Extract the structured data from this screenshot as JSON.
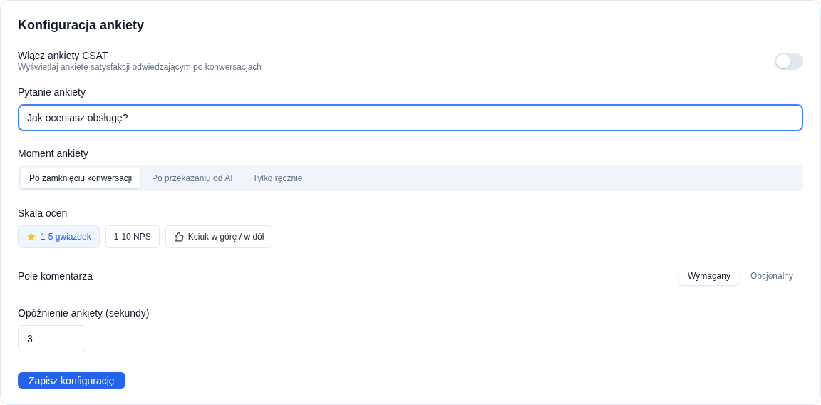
{
  "title": "Konfiguracja ankiety",
  "csat": {
    "label": "Włącz ankiety CSAT",
    "description": "Wyświetlaj ankietę satysfakcji odwiedzającym po konwersacjach",
    "on": false
  },
  "question": {
    "label": "Pytanie ankiety",
    "value": "Jak oceniasz obsługę?"
  },
  "timing": {
    "label": "Moment ankiety",
    "options": [
      {
        "label": "Po zamknięciu konwersacji",
        "selected": true
      },
      {
        "label": "Po przekazaniu od AI",
        "selected": false
      },
      {
        "label": "Tylko ręcznie",
        "selected": false
      }
    ]
  },
  "scale": {
    "label": "Skala ocen",
    "options": [
      {
        "label": "1-5 gwiazdek",
        "kind": "star",
        "selected": true
      },
      {
        "label": "1-10 NPS",
        "kind": "plain",
        "selected": false
      },
      {
        "label": "Kciuk w górę / w dół",
        "kind": "thumb",
        "selected": false
      }
    ]
  },
  "comment": {
    "label": "Pole komentarza",
    "options": [
      {
        "label": "Wymagany",
        "selected": true
      },
      {
        "label": "Opcjonalny",
        "selected": false
      }
    ]
  },
  "delay": {
    "label": "Opóźnienie ankiety (sekundy)",
    "value": "3"
  },
  "save_button": "Zapisz konfigurację"
}
